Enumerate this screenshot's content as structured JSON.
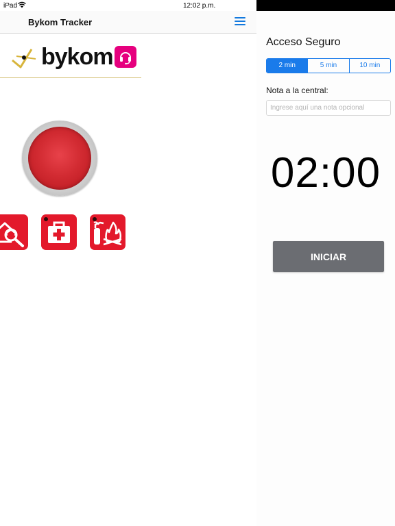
{
  "status_bar": {
    "device": "iPad",
    "time": "12:02 p.m."
  },
  "nav": {
    "title": "Bykom Tracker",
    "menu_icon": "hamburger-menu-icon"
  },
  "brand": {
    "logo_text": "bykom",
    "accent": "#e6007e",
    "gold": "#d8b53c"
  },
  "emergency": {
    "panic_color": "#d22b32",
    "buttons": [
      {
        "icon": "security-search-icon"
      },
      {
        "icon": "medical-kit-icon"
      },
      {
        "icon": "fire-extinguisher-icon"
      }
    ],
    "button_color": "#e3192b"
  },
  "secure_access": {
    "title": "Acceso Seguro",
    "durations": [
      "2 min",
      "5 min",
      "10 min"
    ],
    "selected_duration": "2 min",
    "note_label": "Nota a la central:",
    "note_placeholder": "Ingrese aquí una nota opcional",
    "note_value": "",
    "timer": "02:00",
    "start_label": "INICIAR",
    "accent": "#1a7bea"
  }
}
